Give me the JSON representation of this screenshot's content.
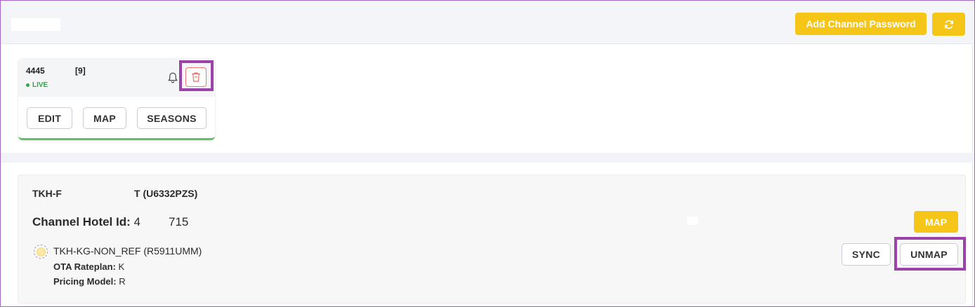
{
  "header": {
    "add_password_label": "Add Channel Password",
    "refresh_icon": "refresh-icon",
    "accent_color": "#f5c518"
  },
  "rate_card": {
    "id_prefix": "4445",
    "id_suffix": "[9]",
    "status": "LIVE",
    "status_color": "#2daa44",
    "bell_icon": "bell-icon",
    "delete_icon": "trash-icon",
    "buttons": {
      "edit": "EDIT",
      "map": "MAP",
      "seasons": "SEASONS"
    }
  },
  "mapping": {
    "hotel_name_prefix": "TKH-F",
    "hotel_name_suffix": "T (U6332PZS)",
    "hotel_id_label": "Channel Hotel Id:",
    "hotel_id_prefix": "4",
    "hotel_id_suffix": "715",
    "map_label": "MAP",
    "rateplan": {
      "name": "TKH-KG-NON_REF (R5911UMM)",
      "ota_label": "OTA Rateplan:",
      "ota_value": "K",
      "pricing_label": "Pricing Model:",
      "pricing_value": "R",
      "sync_label": "SYNC",
      "unmap_label": "UNMAP"
    }
  },
  "annotation_color": "#9b43a8"
}
